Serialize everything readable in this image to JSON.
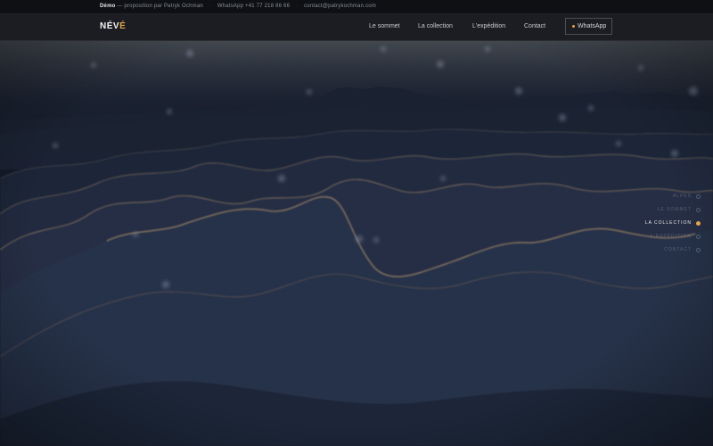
{
  "topbar": {
    "demo": "Démo",
    "proposal": "— proposition par Patryk Ochman",
    "whatsapp": "WhatsApp +41 77 218 86 66",
    "email": "contact@patrykochman.com",
    "separator": "·"
  },
  "header": {
    "logo_main": "NÉV",
    "logo_accent": "É",
    "nav": [
      "Le sommet",
      "La collection",
      "L'expédition",
      "Contact"
    ],
    "whatsapp_button": "WhatsApp"
  },
  "sections": {
    "active_index": 2,
    "items": [
      "Alpes",
      "Le sommet",
      "La collection",
      "L'expédition",
      "Contact"
    ]
  },
  "colors": {
    "accent": "#e3a447",
    "background": "#141a26",
    "header": "#1b1d22"
  }
}
